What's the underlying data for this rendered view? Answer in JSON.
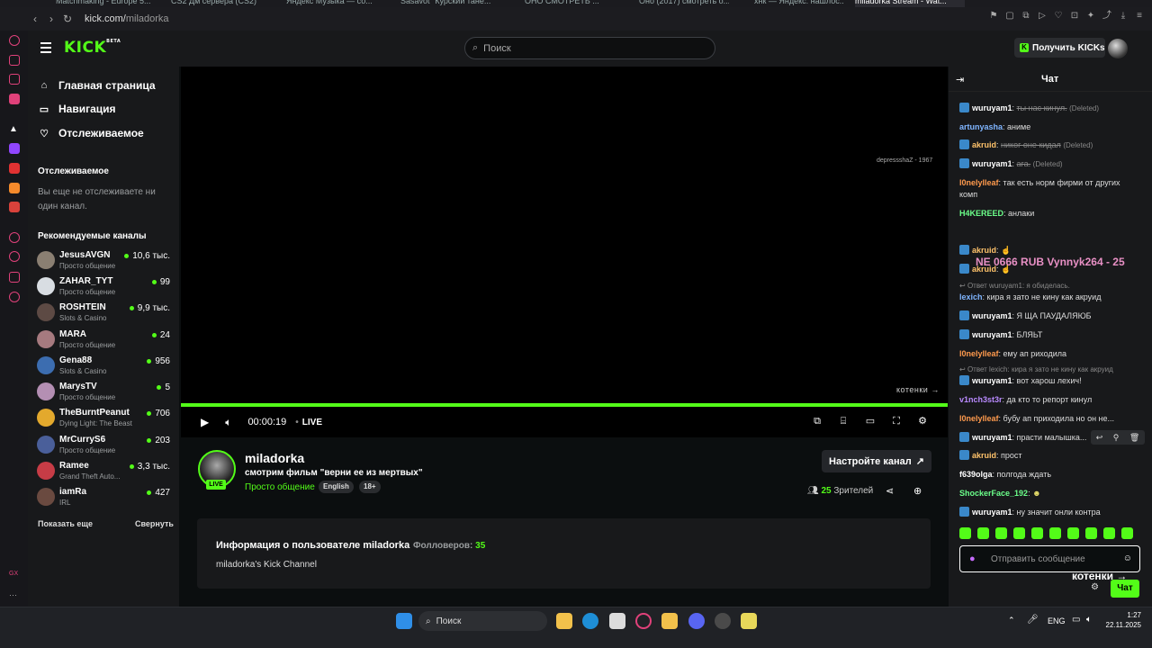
{
  "browser": {
    "tabs": [
      {
        "label": "Matchmaking - Europe 5..."
      },
      {
        "label": "CS2 Дм сервера (CS2)"
      },
      {
        "label": "Яндекс Музыка — со..."
      },
      {
        "label": "Sasavot \"Курский тане..."
      },
      {
        "label": "ОНО СМОТРЕТЬ ..."
      },
      {
        "label": "Оно (2017) смотреть о..."
      },
      {
        "label": "хнк — Яндекс: нашлос..."
      },
      {
        "label": "miladorka Stream - Wat..."
      }
    ],
    "url_host": "kick.com/",
    "url_path": "miladorka"
  },
  "header": {
    "logo": "KICK",
    "logo_sup": "BETA",
    "search_placeholder": "Поиск",
    "get_kicks_label": "Получить KICKs"
  },
  "sidebar": {
    "nav": [
      {
        "label": "Главная страница",
        "icon": "home-icon"
      },
      {
        "label": "Навигация",
        "icon": "browse-icon"
      },
      {
        "label": "Отслеживаемое",
        "icon": "heart-icon"
      }
    ],
    "following_title": "Отслеживаемое",
    "following_empty": "Вы еще не отслеживаете ни один канал.",
    "recommended_title": "Рекомендуемые каналы",
    "channels": [
      {
        "name": "JesusAVGN",
        "category": "Просто общение",
        "viewers": "10,6 тыс.",
        "color": "#8a7f72"
      },
      {
        "name": "ZAHAR_TYT",
        "category": "Просто общение",
        "viewers": "99",
        "color": "#d8dde2"
      },
      {
        "name": "ROSHTEIN",
        "category": "Slots & Casino",
        "viewers": "9,9 тыс.",
        "color": "#5d4a44"
      },
      {
        "name": "MARA",
        "category": "Просто общение",
        "viewers": "24",
        "color": "#a67a7f"
      },
      {
        "name": "Gena88",
        "category": "Slots & Casino",
        "viewers": "956",
        "color": "#3c6db0"
      },
      {
        "name": "MarysTV",
        "category": "Просто общение",
        "viewers": "5",
        "color": "#b48fb3"
      },
      {
        "name": "TheBurntPeanut",
        "category": "Dying Light: The Beast",
        "viewers": "706",
        "color": "#e3a92d"
      },
      {
        "name": "MrCurryS6",
        "category": "Просто общение",
        "viewers": "203",
        "color": "#4a5f9a"
      },
      {
        "name": "Ramee",
        "category": "Grand Theft Auto...",
        "viewers": "3,3 тыс.",
        "color": "#c73c46"
      },
      {
        "name": "iamRa",
        "category": "IRL",
        "viewers": "427",
        "color": "#6a4a40"
      }
    ],
    "show_more": "Показать еще",
    "collapse": "Свернуть"
  },
  "player": {
    "watermark": "depressshaZ - 1967",
    "overlay_text": "котенки",
    "time": "00:00:19",
    "live_label": "LIVE",
    "progress": 1.0
  },
  "channel": {
    "name": "miladorka",
    "live_badge": "LIVE",
    "title": "смотрим фильм \"верни ее из мертвых\"",
    "category": "Просто общение",
    "tags": [
      "English",
      "18+"
    ],
    "setup_label": "Настройте канал",
    "viewers_count": "25",
    "viewers_label": "Зрителей"
  },
  "about": {
    "title": "Информация о пользователе miladorka",
    "followers_label": "Фолловеров:",
    "followers_count": "35",
    "description": "miladorka's Kick Channel"
  },
  "chat": {
    "title": "Чат",
    "overlay": "NE 0666 RUB  Vynnyk264 - 25",
    "messages": [
      {
        "user": "wuruyam1",
        "color": "#ffffff",
        "text": "ты нас кинул.",
        "deleted": true,
        "badge": true
      },
      {
        "user": "artunyasha",
        "color": "#7fb5ff",
        "text": "аниме"
      },
      {
        "user": "akruid",
        "color": "#ffc36b",
        "text": "никог оне кидал",
        "deleted": true,
        "badge": true
      },
      {
        "user": "wuruyam1",
        "color": "#ffffff",
        "text": "ага.",
        "deleted": true,
        "badge": true
      },
      {
        "user": "l0nelylleaf",
        "color": "#ff9a4d",
        "text": "так есть норм фирми от других комп"
      },
      {
        "user": "H4KEREED",
        "color": "#6bff8a",
        "text": "анлаки"
      },
      {
        "user": "akruid",
        "color": "#ffc36b",
        "text": "",
        "badge": true
      },
      {
        "user": "akruid",
        "color": "#ffc36b",
        "text": "",
        "badge": true
      },
      {
        "user": "lexich",
        "color": "#7fb5ff",
        "text": "кира я зато не кину как акруид",
        "reply": "Ответ wuruyam1: я обиделась."
      },
      {
        "user": "wuruyam1",
        "color": "#ffffff",
        "text": "Я ЩА ПАУДАЛЯЮБ",
        "badge": true
      },
      {
        "user": "wuruyam1",
        "color": "#ffffff",
        "text": "БЛЯЬТ",
        "badge": true
      },
      {
        "user": "l0nelylleaf",
        "color": "#ff9a4d",
        "text": "ему ап риходила"
      },
      {
        "user": "wuruyam1",
        "color": "#ffffff",
        "text": "вот харош лехич!",
        "badge": true,
        "reply": "Ответ lexich: кира я зато не кину как акруид"
      },
      {
        "user": "v1nch3st3r",
        "color": "#b98aff",
        "text": "да кто то репорт кинул"
      },
      {
        "user": "l0nelylleaf",
        "color": "#ff9a4d",
        "text": "бубу ап приходила но он не..."
      },
      {
        "user": "wuruyam1",
        "color": "#ffffff",
        "text": "прасти малышка...",
        "badge": true
      },
      {
        "user": "akruid",
        "color": "#ffc36b",
        "text": "прост",
        "badge": true
      },
      {
        "user": "f639olga",
        "color": "#ffffff",
        "text": "полгода ждать"
      },
      {
        "user": "ShockerFace_192",
        "color": "#6bff8a",
        "text": ""
      },
      {
        "user": "wuruyam1",
        "color": "#ffffff",
        "text": "ну значит онли контра",
        "badge": true
      }
    ],
    "deleted_label": "(Deleted)",
    "input_placeholder": "Отправить сообщение",
    "send_label": "Чат",
    "overlay_kotenki": "котенки"
  },
  "taskbar": {
    "search_label": "Поиск",
    "lang": "ENG",
    "time": "1:27",
    "date": "22.11.2025"
  }
}
